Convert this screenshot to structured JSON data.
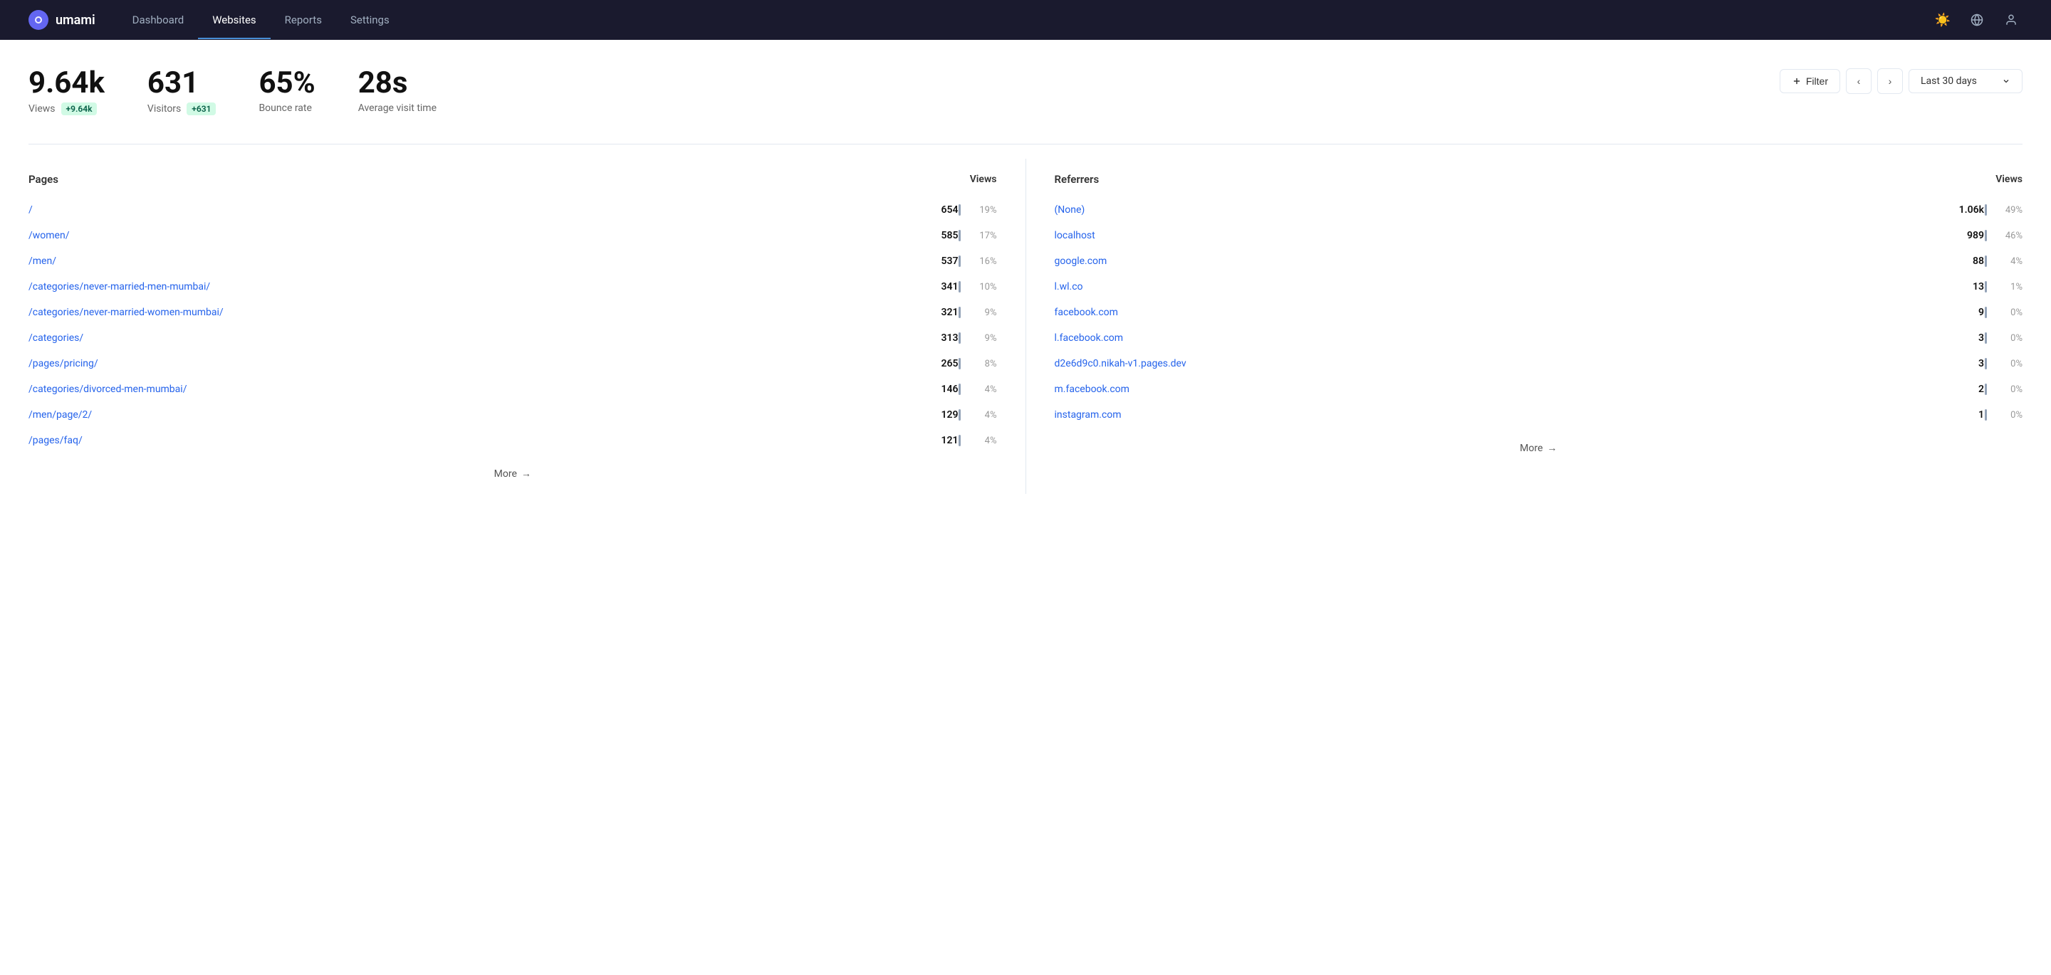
{
  "brand": {
    "name": "umami",
    "icon": "●"
  },
  "nav": {
    "links": [
      {
        "label": "Dashboard",
        "active": false
      },
      {
        "label": "Websites",
        "active": true
      },
      {
        "label": "Reports",
        "active": false
      },
      {
        "label": "Settings",
        "active": false
      }
    ],
    "icons": {
      "theme": "☀",
      "globe": "🌐",
      "user": "👤"
    }
  },
  "stats": [
    {
      "value": "9.64k",
      "label": "Views",
      "badge": "+9.64k",
      "badge_type": "green"
    },
    {
      "value": "631",
      "label": "Visitors",
      "badge": "+631",
      "badge_type": "green"
    },
    {
      "value": "65%",
      "label": "Bounce rate",
      "badge": null
    },
    {
      "value": "28s",
      "label": "Average visit time",
      "badge": null
    }
  ],
  "controls": {
    "filter_label": "+ Filter",
    "prev_icon": "‹",
    "next_icon": "›",
    "date_range": "Last 30 days",
    "date_dropdown": "▾"
  },
  "pages_table": {
    "title": "Pages",
    "col_header": "Views",
    "rows": [
      {
        "path": "/",
        "views": "654",
        "pct": "19%"
      },
      {
        "path": "/women/",
        "views": "585",
        "pct": "17%"
      },
      {
        "path": "/men/",
        "views": "537",
        "pct": "16%"
      },
      {
        "path": "/categories/never-married-men-mumbai/",
        "views": "341",
        "pct": "10%"
      },
      {
        "path": "/categories/never-married-women-mumbai/",
        "views": "321",
        "pct": "9%"
      },
      {
        "path": "/categories/",
        "views": "313",
        "pct": "9%"
      },
      {
        "path": "/pages/pricing/",
        "views": "265",
        "pct": "8%"
      },
      {
        "path": "/categories/divorced-men-mumbai/",
        "views": "146",
        "pct": "4%"
      },
      {
        "path": "/men/page/2/",
        "views": "129",
        "pct": "4%"
      },
      {
        "path": "/pages/faq/",
        "views": "121",
        "pct": "4%"
      }
    ],
    "more_label": "More",
    "more_arrow": "→"
  },
  "referrers_table": {
    "title": "Referrers",
    "col_header": "Views",
    "rows": [
      {
        "path": "(None)",
        "views": "1.06k",
        "pct": "49%"
      },
      {
        "path": "localhost",
        "views": "989",
        "pct": "46%"
      },
      {
        "path": "google.com",
        "views": "88",
        "pct": "4%"
      },
      {
        "path": "l.wl.co",
        "views": "13",
        "pct": "1%"
      },
      {
        "path": "facebook.com",
        "views": "9",
        "pct": "0%"
      },
      {
        "path": "l.facebook.com",
        "views": "3",
        "pct": "0%"
      },
      {
        "path": "d2e6d9c0.nikah-v1.pages.dev",
        "views": "3",
        "pct": "0%"
      },
      {
        "path": "m.facebook.com",
        "views": "2",
        "pct": "0%"
      },
      {
        "path": "instagram.com",
        "views": "1",
        "pct": "0%"
      }
    ],
    "more_label": "More",
    "more_arrow": "→"
  }
}
